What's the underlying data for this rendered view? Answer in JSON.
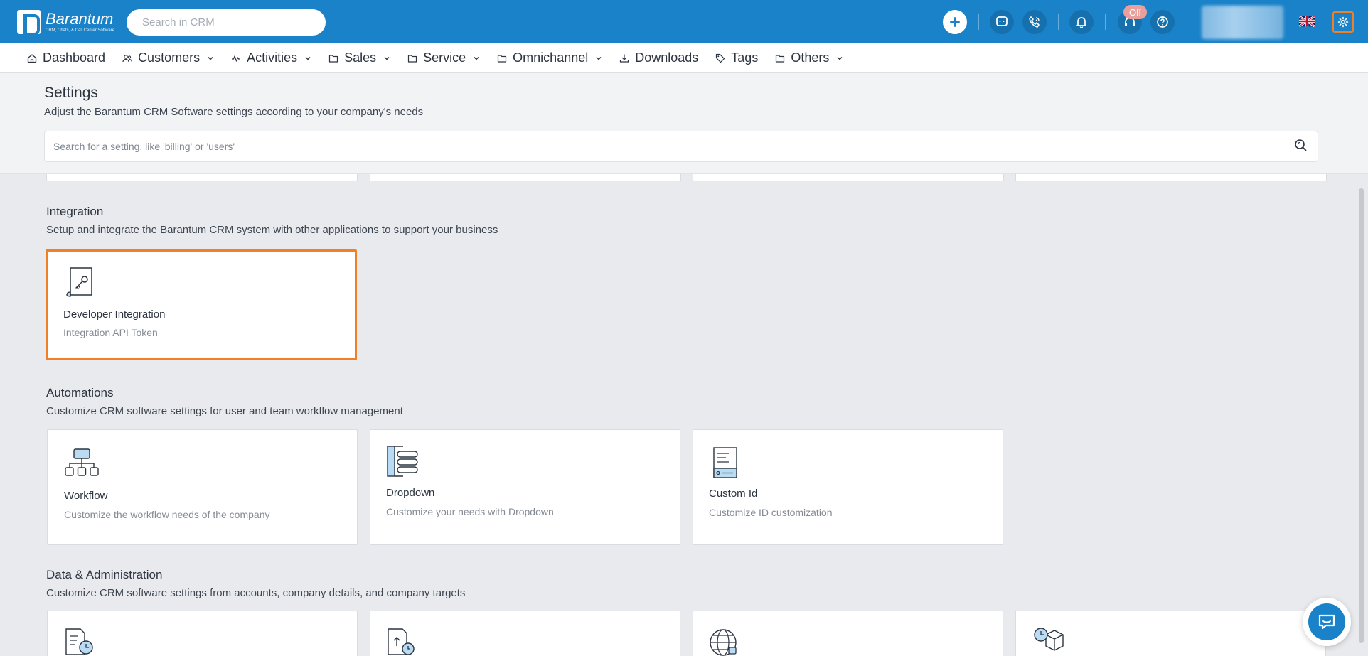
{
  "topbar": {
    "brand_name": "Barantum",
    "brand_tagline": "CRM, Chats, & Call Center Software",
    "search_placeholder": "Search in CRM",
    "status_badge": "Off"
  },
  "nav": {
    "items": [
      {
        "label": "Dashboard",
        "icon": "home-icon"
      },
      {
        "label": "Customers",
        "icon": "users-icon"
      },
      {
        "label": "Activities",
        "icon": "activity-icon"
      },
      {
        "label": "Sales",
        "icon": "folder-icon"
      },
      {
        "label": "Service",
        "icon": "folder-icon"
      },
      {
        "label": "Omnichannel",
        "icon": "folder-icon"
      },
      {
        "label": "Downloads",
        "icon": "download-icon"
      },
      {
        "label": "Tags",
        "icon": "tag-icon"
      },
      {
        "label": "Others",
        "icon": "folder-icon"
      }
    ]
  },
  "settings": {
    "title": "Settings",
    "subtitle": "Adjust the Barantum CRM Software settings according to your company's needs",
    "search_placeholder": "Search for a setting, like 'billing' or 'users'"
  },
  "sections": {
    "integration": {
      "title": "Integration",
      "subtitle": "Setup and integrate the Barantum CRM system with other applications to support your business",
      "cards": [
        {
          "title": "Developer Integration",
          "desc": "Integration API Token"
        }
      ]
    },
    "automations": {
      "title": "Automations",
      "subtitle": "Customize CRM software settings for user and team workflow management",
      "cards": [
        {
          "title": "Workflow",
          "desc": "Customize the workflow needs of the company"
        },
        {
          "title": "Dropdown",
          "desc": "Customize your needs with Dropdown"
        },
        {
          "title": "Custom Id",
          "desc": "Customize ID customization"
        }
      ]
    },
    "data_admin": {
      "title": "Data & Administration",
      "subtitle": "Customize CRM software settings from accounts, company details, and company targets"
    }
  },
  "colors": {
    "brand_blue": "#1a82c8",
    "highlight_orange": "#f08025"
  }
}
